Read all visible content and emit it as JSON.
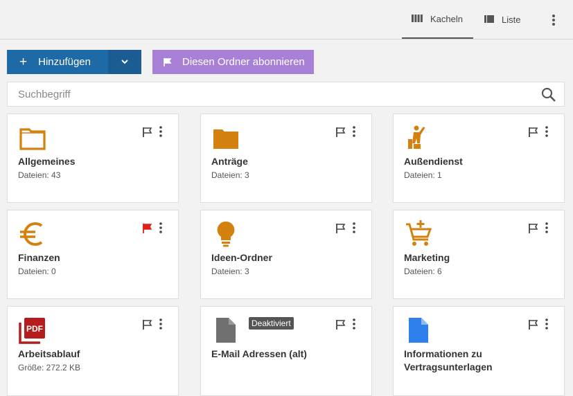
{
  "view_tabs": {
    "tiles_label": "Kacheln",
    "list_label": "Liste"
  },
  "toolbar": {
    "add_label": "Hinzufügen",
    "subscribe_label": "Diesen Ordner abonnieren"
  },
  "search": {
    "placeholder": "Suchbegriff",
    "value": ""
  },
  "colors": {
    "primary": "#1e6aa6",
    "subscribe": "#a880d8",
    "folder_icon": "#d4820f",
    "flag_active": "#e0201b"
  },
  "cards": [
    {
      "title": "Allgemeines",
      "meta": "Dateien: 43",
      "icon": "folder-outline-icon",
      "flagged": false
    },
    {
      "title": "Anträge",
      "meta": "Dateien: 3",
      "icon": "folder-filled-icon",
      "flagged": false
    },
    {
      "title": "Außendienst",
      "meta": "Dateien: 1",
      "icon": "field-worker-icon",
      "flagged": false
    },
    {
      "title": "Finanzen",
      "meta": "Dateien: 0",
      "icon": "euro-icon",
      "flagged": true
    },
    {
      "title": "Ideen-Ordner",
      "meta": "Dateien: 3",
      "icon": "lightbulb-icon",
      "flagged": false
    },
    {
      "title": "Marketing",
      "meta": "Dateien: 6",
      "icon": "cart-plus-icon",
      "flagged": false
    },
    {
      "title": "Arbeitsablauf",
      "meta": "Größe: 272.2 KB",
      "icon": "pdf-file-icon",
      "flagged": false
    },
    {
      "title": "E-Mail Adressen (alt)",
      "meta": "",
      "icon": "document-gray-icon",
      "flagged": false,
      "badge": "Deaktiviert"
    },
    {
      "title": "Informationen zu Vertragsunterlagen",
      "meta": "",
      "icon": "document-blue-icon",
      "flagged": false
    }
  ]
}
